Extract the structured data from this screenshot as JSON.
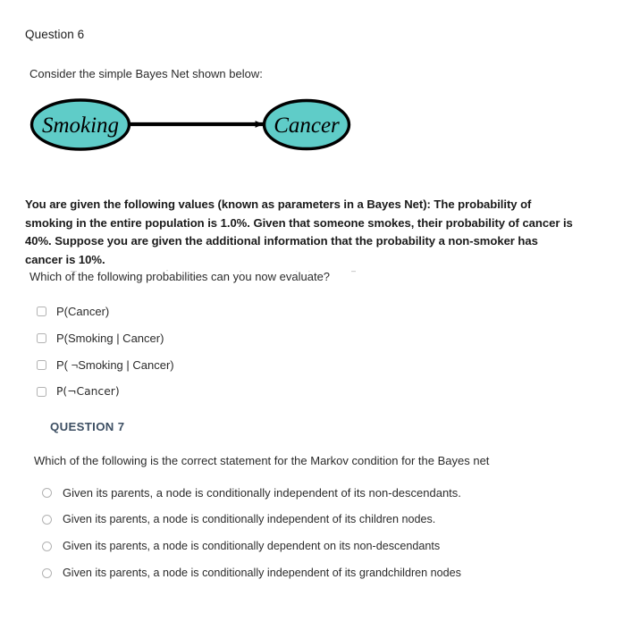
{
  "question6": {
    "heading": "Question 6",
    "intro": "Consider the simple Bayes Net shown below:",
    "diagram": {
      "node_fill": "#5fccc8",
      "node_stroke": "#000000",
      "nodes": [
        {
          "id": "smoking",
          "label": "Smoking"
        },
        {
          "id": "cancer",
          "label": "Cancer"
        }
      ],
      "edges": [
        {
          "from": "Smoking",
          "to": "Cancer"
        }
      ]
    },
    "parameters_text": "You are given the following values (known as parameters in a Bayes Net): The probability of smoking in the entire population is 1.0%. Given that someone smokes, their probability of cancer is 40%. Suppose you are given the additional information that the probability a non-smoker has cancer is 10%.",
    "prompt": "Which of the following probabilities can you now evaluate?",
    "options": [
      {
        "label": "P(Cancer)",
        "checked": false
      },
      {
        "label": "P(Smoking | Cancer)",
        "checked": false
      },
      {
        "label": "P( ¬Smoking | Cancer)",
        "checked": false
      },
      {
        "label": "P(¬Cancer)",
        "checked": false
      }
    ]
  },
  "question7": {
    "heading": "QUESTION 7",
    "heading_color": "#3d4f63",
    "prompt": "Which of the following is the correct statement for the Markov condition for the Bayes net",
    "options": [
      {
        "label": "Given its parents, a node is conditionally independent of its non-descendants.",
        "selected": false
      },
      {
        "label": "Given its parents, a node is conditionally independent of its children nodes.",
        "selected": false
      },
      {
        "label": "Given its parents, a node is conditionally dependent on its non-descendants",
        "selected": false
      },
      {
        "label": "Given its parents, a node is conditionally independent of its grandchildren nodes",
        "selected": false
      }
    ]
  }
}
